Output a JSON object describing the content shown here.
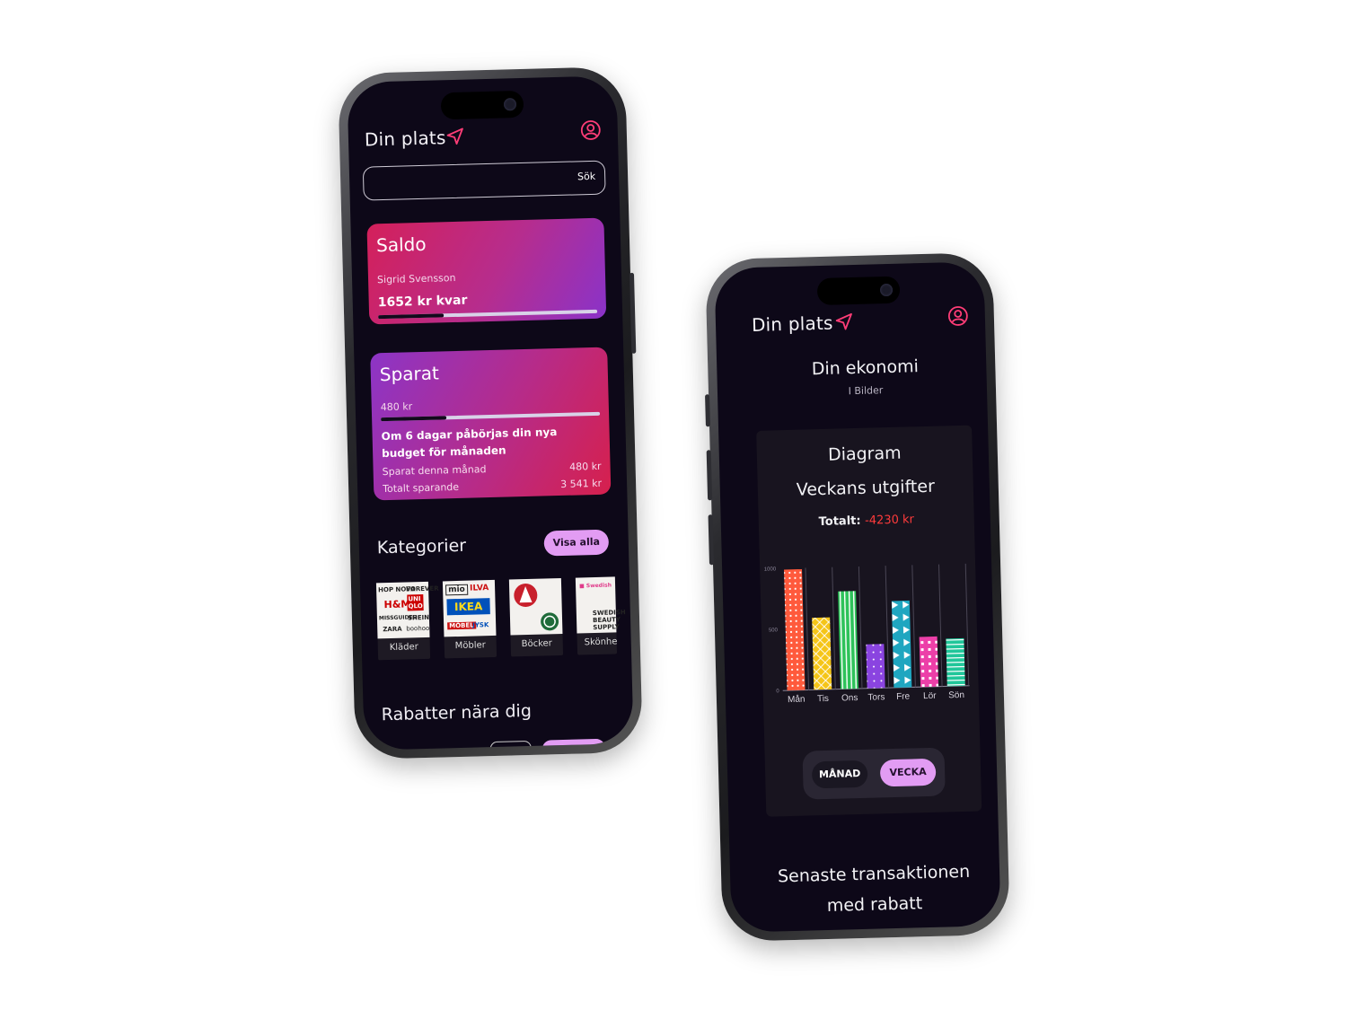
{
  "left_screen": {
    "header": {
      "title": "Din plats",
      "nav_icon": "navigation-arrow-icon",
      "profile_icon": "user-circle-icon"
    },
    "search": {
      "button_label": "Sök",
      "value": ""
    },
    "saldo": {
      "title": "Saldo",
      "owner": "Sigrid Svensson",
      "remaining": "1652 kr kvar",
      "progress": 0.3
    },
    "sparat": {
      "title": "Sparat",
      "amount": "480 kr",
      "progress": 0.3,
      "message": "Om 6 dagar påbörjas din nya budget för månaden",
      "rows": [
        {
          "label": "Sparat denna månad",
          "value": "480 kr"
        },
        {
          "label": "Totalt sparande",
          "value": "3 541 kr"
        }
      ]
    },
    "categories": {
      "title": "Kategorier",
      "show_all": "Visa alla",
      "items": [
        {
          "label": "Kläder",
          "logos": [
            "HOP",
            "NOVA",
            "FOREVER",
            "H&M",
            "UNI QLO",
            "MISSGUIDED",
            "SHEIN",
            "ZARA",
            "boohoo"
          ]
        },
        {
          "label": "Möbler",
          "logos": [
            "mio",
            "ILVA",
            "IKEA",
            "JYSK"
          ]
        },
        {
          "label": "Böcker",
          "logos": []
        },
        {
          "label": "Skönhe",
          "logos": [
            "SWEDISH",
            "BEAUTY",
            "SUPPLY"
          ]
        }
      ]
    },
    "discounts": {
      "title": "Rabatter nära dig"
    }
  },
  "right_screen": {
    "header": {
      "title": "Din plats",
      "nav_icon": "navigation-arrow-icon",
      "profile_icon": "user-circle-icon"
    },
    "economy": {
      "title": "Din ekonomi",
      "subtitle": "I Bilder"
    },
    "panel": {
      "title": "Diagram",
      "subtitle": "Veckans utgifter",
      "total_label": "Totalt:",
      "total_value": "-4230 kr"
    },
    "toggle": {
      "month": "MÅNAD",
      "week": "VECKA",
      "selected": "week"
    },
    "latest": {
      "line1": "Senaste transaktionen",
      "line2": "med rabatt"
    }
  },
  "chart_data": {
    "type": "bar",
    "title": "Veckans utgifter",
    "categories": [
      "Mån",
      "Tis",
      "Ons",
      "Tors",
      "Fre",
      "Lör",
      "Sön"
    ],
    "values": [
      990,
      590,
      800,
      360,
      710,
      410,
      390
    ],
    "yticks": [
      0,
      500,
      1000
    ],
    "ylim": [
      0,
      1000
    ],
    "colors": [
      "#ff5a3c",
      "#f5c518",
      "#2ec25a",
      "#8a44e0",
      "#1fa6c0",
      "#ec3fa8",
      "#21c69a"
    ],
    "patterns": [
      "dots",
      "cross",
      "stripes-v",
      "stars",
      "triangles",
      "squares",
      "stripes-h"
    ]
  },
  "colors": {
    "accent": "#e29cf3",
    "pink": "#ff3d77",
    "bg": "#0d0818",
    "negative": "#ff3b3b"
  }
}
